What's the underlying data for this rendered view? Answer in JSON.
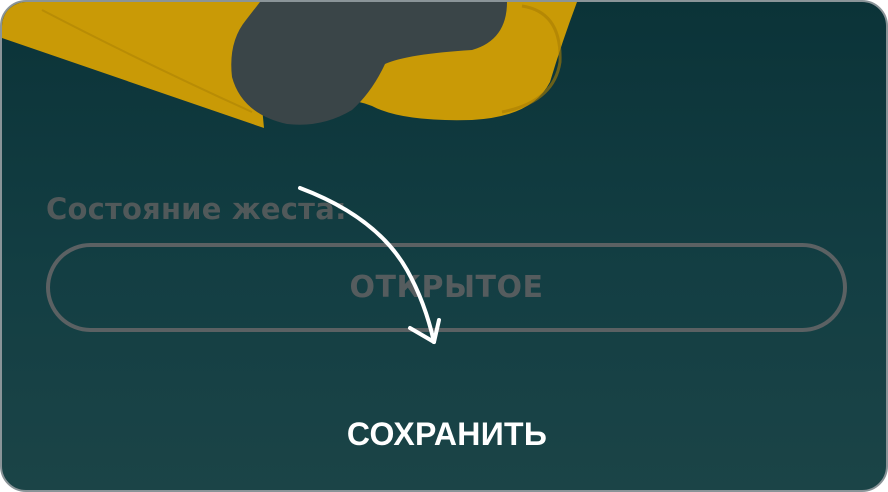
{
  "gesture": {
    "label": "Состояние жеста:",
    "state_value": "ОТКРЫТОЕ"
  },
  "actions": {
    "save_label": "СОХРАНИТЬ"
  },
  "icons": {
    "illustration": "hand-gesture-illustration",
    "arrow": "curved-arrow-icon"
  },
  "colors": {
    "background_top": "#0b3338",
    "background_bottom": "#1b4447",
    "accent_yellow": "#c99a06",
    "muted_text": "#51595a",
    "save_text": "#ffffff"
  }
}
